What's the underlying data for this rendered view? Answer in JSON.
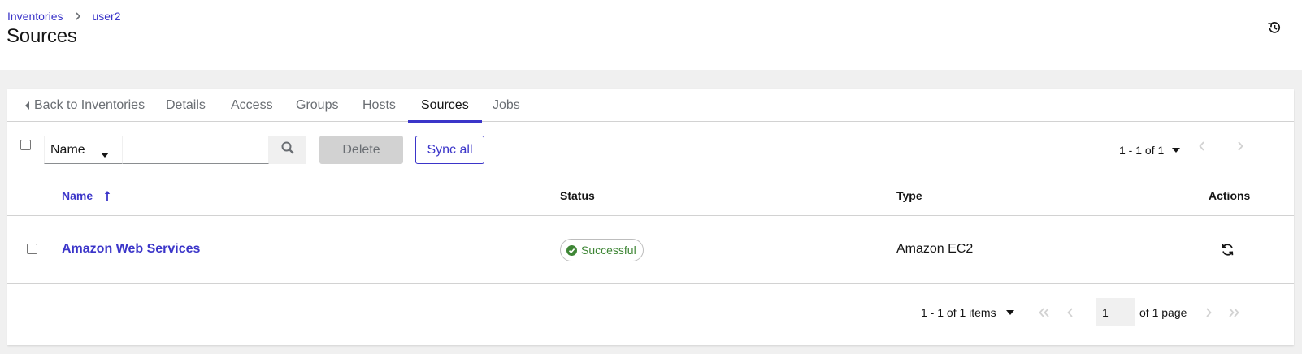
{
  "breadcrumb": {
    "items": [
      "Inventories",
      "user2"
    ]
  },
  "page": {
    "title": "Sources"
  },
  "tabs": [
    {
      "label": "Back to Inventories"
    },
    {
      "label": "Details"
    },
    {
      "label": "Access"
    },
    {
      "label": "Groups"
    },
    {
      "label": "Hosts"
    },
    {
      "label": "Sources",
      "active": true
    },
    {
      "label": "Jobs"
    }
  ],
  "toolbar": {
    "filter_field": "Name",
    "search_value": "",
    "delete_label": "Delete",
    "sync_all_label": "Sync all",
    "pagination": "1 - 1 of 1"
  },
  "table": {
    "columns": [
      "Name",
      "Status",
      "Type",
      "Actions"
    ],
    "rows": [
      {
        "name": "Amazon Web Services",
        "status": "Successful",
        "type": "Amazon EC2",
        "action_icon": "sync-icon"
      }
    ]
  },
  "footer": {
    "items_range": "1 - 1 of 1 items",
    "page_value": "1",
    "of_pages": "of 1 page"
  },
  "colors": {
    "accent": "#3b35c9",
    "success": "#3e8635",
    "border": "#d2d2d2",
    "muted": "#6a6e73"
  },
  "icons": [
    "chevron-right-icon",
    "history-icon",
    "caret-left-icon",
    "caret-down-icon",
    "search-icon",
    "angle-left-icon",
    "angle-right-icon",
    "long-arrow-up-icon",
    "check-circle-icon",
    "sync-icon",
    "angle-double-left-icon",
    "angle-double-right-icon"
  ]
}
